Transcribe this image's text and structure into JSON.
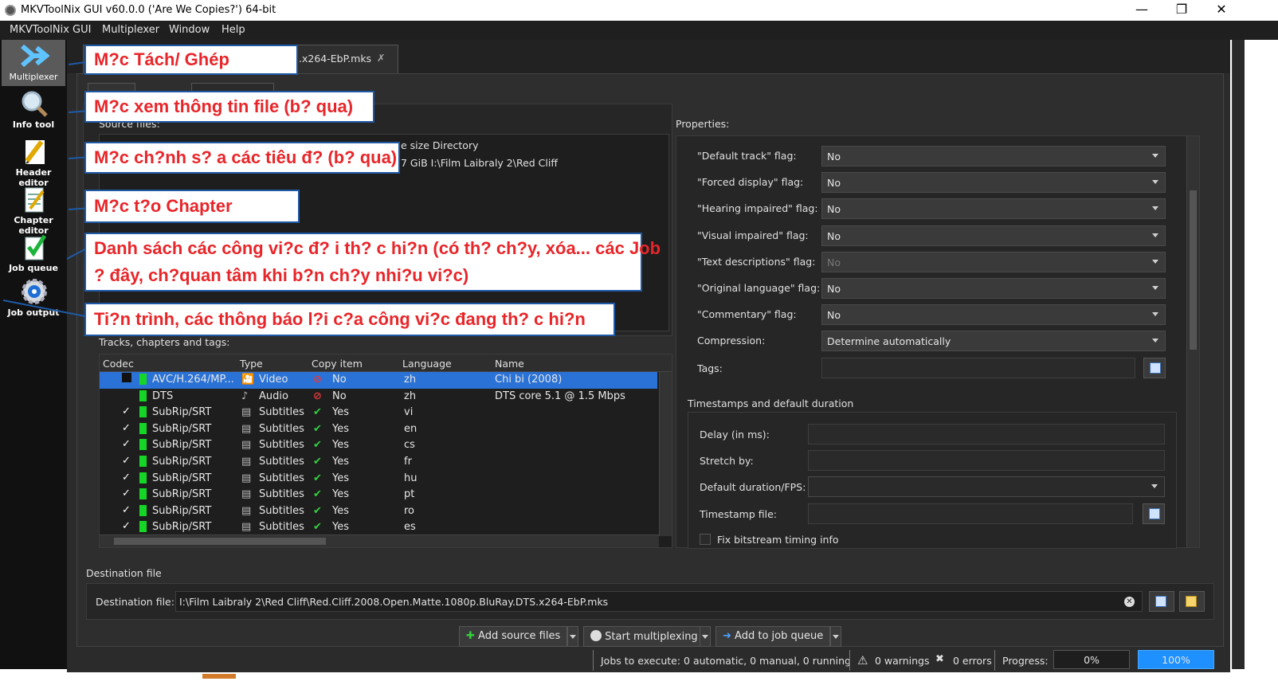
{
  "window": {
    "title": "MKVToolNix GUI v60.0.0 ('Are We Copies?') 64-bit"
  },
  "menu": [
    "MKVToolNix GUI",
    "Multiplexer",
    "Window",
    "Help"
  ],
  "sidebar": [
    {
      "label": "Multiplexer",
      "icon": "multiplexer-icon"
    },
    {
      "label": "Info tool",
      "icon": "magnifier-icon"
    },
    {
      "label": "Header editor",
      "icon": "pencil-icon"
    },
    {
      "label": "Chapter editor",
      "icon": "notepad-icon"
    },
    {
      "label": "Job queue",
      "icon": "checklist-icon"
    },
    {
      "label": "Job output",
      "icon": "gear-icon"
    }
  ],
  "tab": {
    "label": ".x264-EbP.mks"
  },
  "source": {
    "label": "Source files:",
    "header_partial": "e size Directory",
    "row_partial": "7 GiB  I:\\Film Laibraly 2\\Red Cliff"
  },
  "tracks": {
    "label": "Tracks, chapters and tags:",
    "columns": [
      "Codec",
      "Type",
      "Copy item",
      "Language",
      "Name"
    ],
    "rows": [
      {
        "checked": false,
        "codec": "AVC/H.264/MP...",
        "type": "Video",
        "copy": "No",
        "lang": "zh",
        "name": "Chi bi (2008)"
      },
      {
        "checked": false,
        "codec": "DTS",
        "type": "Audio",
        "copy": "No",
        "lang": "zh",
        "name": "DTS core 5.1 @ 1.5 Mbps"
      },
      {
        "checked": true,
        "codec": "SubRip/SRT",
        "type": "Subtitles",
        "copy": "Yes",
        "lang": "vi",
        "name": ""
      },
      {
        "checked": true,
        "codec": "SubRip/SRT",
        "type": "Subtitles",
        "copy": "Yes",
        "lang": "en",
        "name": ""
      },
      {
        "checked": true,
        "codec": "SubRip/SRT",
        "type": "Subtitles",
        "copy": "Yes",
        "lang": "cs",
        "name": ""
      },
      {
        "checked": true,
        "codec": "SubRip/SRT",
        "type": "Subtitles",
        "copy": "Yes",
        "lang": "fr",
        "name": ""
      },
      {
        "checked": true,
        "codec": "SubRip/SRT",
        "type": "Subtitles",
        "copy": "Yes",
        "lang": "hu",
        "name": ""
      },
      {
        "checked": true,
        "codec": "SubRip/SRT",
        "type": "Subtitles",
        "copy": "Yes",
        "lang": "pt",
        "name": ""
      },
      {
        "checked": true,
        "codec": "SubRip/SRT",
        "type": "Subtitles",
        "copy": "Yes",
        "lang": "ro",
        "name": ""
      },
      {
        "checked": true,
        "codec": "SubRip/SRT",
        "type": "Subtitles",
        "copy": "Yes",
        "lang": "es",
        "name": ""
      }
    ]
  },
  "properties": {
    "label": "Properties:",
    "fields": [
      {
        "label": "\"Default track\" flag:",
        "value": "No",
        "disabled": false
      },
      {
        "label": "\"Forced display\" flag:",
        "value": "No",
        "disabled": false
      },
      {
        "label": "\"Hearing impaired\" flag:",
        "value": "No",
        "disabled": false
      },
      {
        "label": "\"Visual impaired\" flag:",
        "value": "No",
        "disabled": false
      },
      {
        "label": "\"Text descriptions\" flag:",
        "value": "No",
        "disabled": true
      },
      {
        "label": "\"Original language\" flag:",
        "value": "No",
        "disabled": false
      },
      {
        "label": "\"Commentary\" flag:",
        "value": "No",
        "disabled": false
      },
      {
        "label": "Compression:",
        "value": "Determine automatically",
        "disabled": false
      }
    ],
    "tags_label": "Tags:",
    "timestamps_group": "Timestamps and default duration",
    "delay_label": "Delay (in ms):",
    "stretch_label": "Stretch by:",
    "duration_label": "Default duration/FPS:",
    "tsfile_label": "Timestamp file:",
    "fix_label": "Fix bitstream timing info"
  },
  "destination": {
    "group": "Destination file",
    "label": "Destination file:",
    "value": "I:\\Film Laibraly 2\\Red Cliff\\Red.Cliff.2008.Open.Matte.1080p.BluRay.DTS.x264-EbP.mks"
  },
  "buttons": {
    "add": "Add source files",
    "start": "Start multiplexing",
    "queue": "Add to job queue"
  },
  "status": {
    "jobs": "Jobs to execute:  0 automatic, 0 manual, 0 running",
    "warnings": "0 warnings",
    "errors": "0 errors",
    "progress_label": "Progress:",
    "progress1": "0%",
    "progress2": "100%"
  },
  "callouts": [
    "M?c Tách/ Ghép",
    "M?c xem thông tin file (b? qua)",
    "M?c ch?nh s? a các tiêu đ? (b? qua)",
    "M?c t?o Chapter",
    "Danh sách các công vi?c đ? i th? c hi?n (có th? ch?y, xóa... các Job",
    "? đây, ch?quan tâm khi b?n ch?y nhi?u vi?c)",
    "Ti?n trình, các thông báo l?i c?a công vi?c đang th? c hi?n"
  ],
  "colors": {
    "accent": "#2a72d6",
    "callout_text": "#e8262a",
    "callout_border": "#1f5aa6",
    "progress_fill": "#1e90ff"
  }
}
